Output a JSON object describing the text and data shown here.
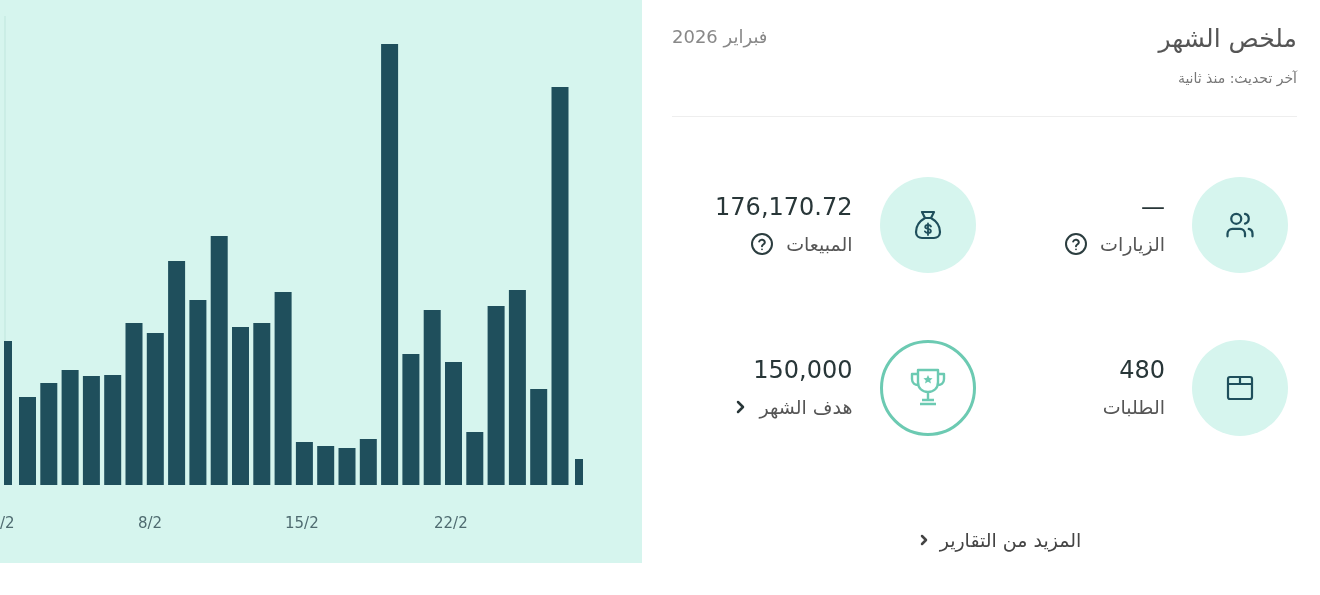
{
  "chart": {
    "x_labels": [
      "22/2",
      "15/2",
      "8/2",
      "/2"
    ]
  },
  "header": {
    "title": "ملخص الشهر",
    "period": "فبراير 2026",
    "updated": "آخر تحديث: منذ ثانية"
  },
  "stats": [
    {
      "kind": "visits",
      "value": "—",
      "label": "الزيارات",
      "help": true,
      "link": false
    },
    {
      "kind": "sales",
      "value": "176,170.72",
      "label": "المبيعات",
      "help": true,
      "link": false
    },
    {
      "kind": "orders",
      "value": "480",
      "label": "الطلبات",
      "help": false,
      "link": false
    },
    {
      "kind": "goal",
      "value": "150,000",
      "label": "هدف الشهر",
      "help": false,
      "link": true
    }
  ],
  "more_link": {
    "label": "المزيد من التقارير"
  }
}
